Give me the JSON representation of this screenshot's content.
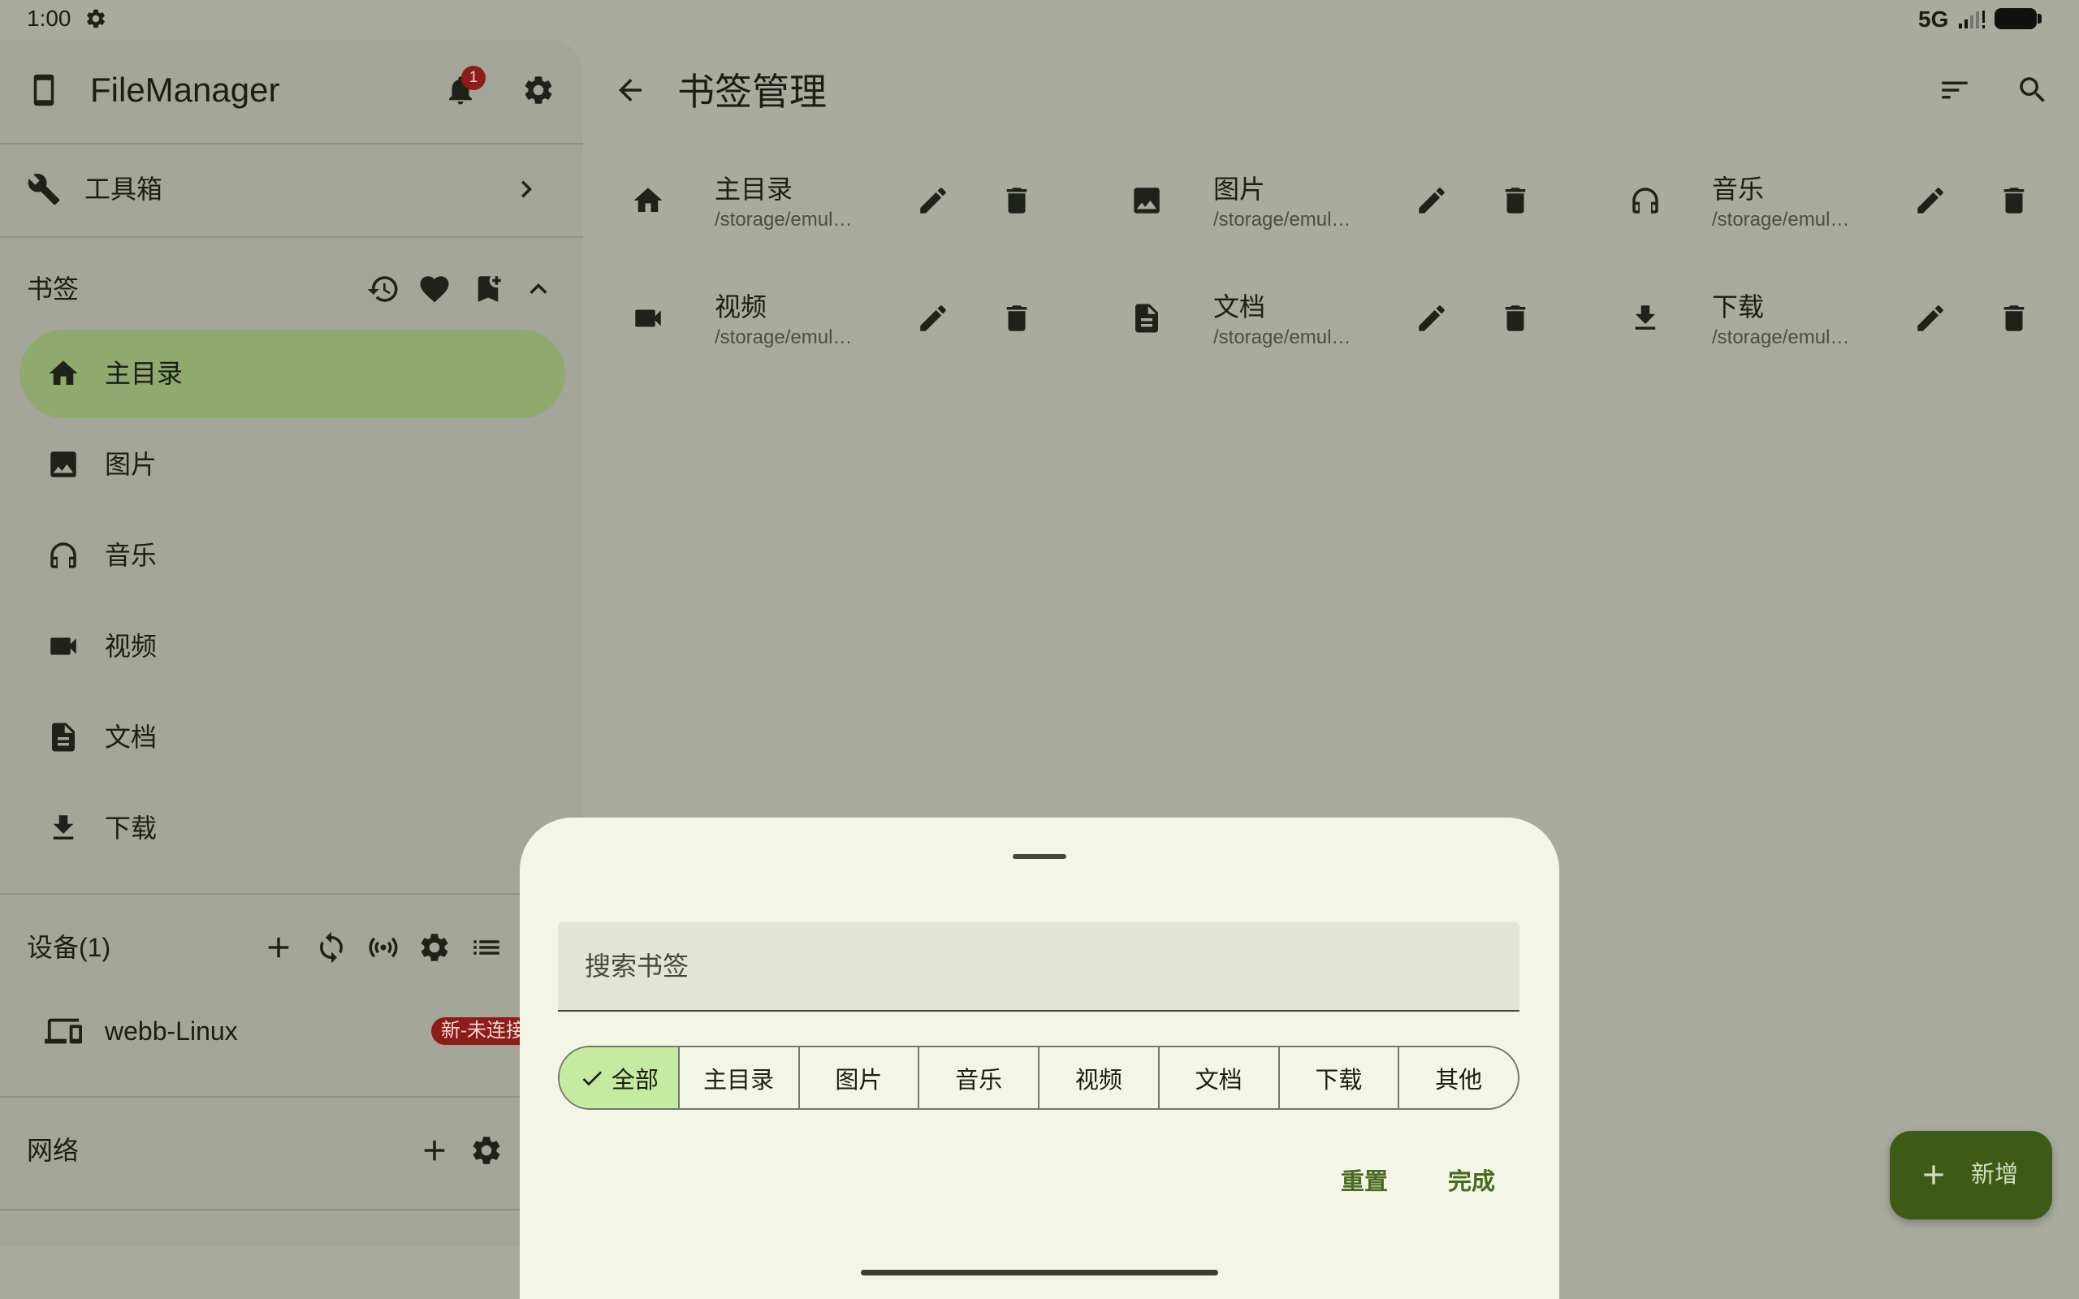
{
  "status_bar": {
    "time": "1:00",
    "network": "5G"
  },
  "drawer": {
    "app_title": "FileManager",
    "notification_count": "1",
    "toolbox_label": "工具箱",
    "bookmarks_header": "书签",
    "bookmarks": [
      {
        "label": "主目录",
        "icon": "home-icon",
        "selected": true
      },
      {
        "label": "图片",
        "icon": "image-icon",
        "selected": false
      },
      {
        "label": "音乐",
        "icon": "headphones-icon",
        "selected": false
      },
      {
        "label": "视频",
        "icon": "videocam-icon",
        "selected": false
      },
      {
        "label": "文档",
        "icon": "document-icon",
        "selected": false
      },
      {
        "label": "下载",
        "icon": "download-icon",
        "selected": false
      }
    ],
    "devices_header": "设备(1)",
    "devices": [
      {
        "name": "webb-Linux",
        "status": "新-未连接",
        "icon": "devices-icon"
      }
    ],
    "network_header": "网络"
  },
  "main": {
    "title": "书签管理",
    "bookmarks": [
      {
        "name": "主目录",
        "path": "/storage/emul…",
        "icon": "home-icon"
      },
      {
        "name": "图片",
        "path": "/storage/emul…",
        "icon": "image-icon"
      },
      {
        "name": "音乐",
        "path": "/storage/emul…",
        "icon": "headphones-icon"
      },
      {
        "name": "视频",
        "path": "/storage/emul…",
        "icon": "videocam-icon"
      },
      {
        "name": "文档",
        "path": "/storage/emul…",
        "icon": "document-icon"
      },
      {
        "name": "下载",
        "path": "/storage/emul…",
        "icon": "download-icon"
      }
    ]
  },
  "sheet": {
    "search_placeholder": "搜索书签",
    "filters": [
      {
        "label": "全部",
        "selected": true
      },
      {
        "label": "主目录",
        "selected": false
      },
      {
        "label": "图片",
        "selected": false
      },
      {
        "label": "音乐",
        "selected": false
      },
      {
        "label": "视频",
        "selected": false
      },
      {
        "label": "文档",
        "selected": false
      },
      {
        "label": "下载",
        "selected": false
      },
      {
        "label": "其他",
        "selected": false
      }
    ],
    "reset_label": "重置",
    "done_label": "完成"
  },
  "fab": {
    "label": "新增",
    "icon": "add-icon"
  },
  "colors": {
    "page_background": "#a9ab9f",
    "drawer_background": "#a3a699",
    "selected_item": "#8fa96e",
    "sheet_background": "#f3f5e7",
    "selected_filter": "#c5eba0",
    "accent": "#4a6a1f",
    "fab_background": "#3d5b15",
    "badge": "#8c1d18"
  }
}
